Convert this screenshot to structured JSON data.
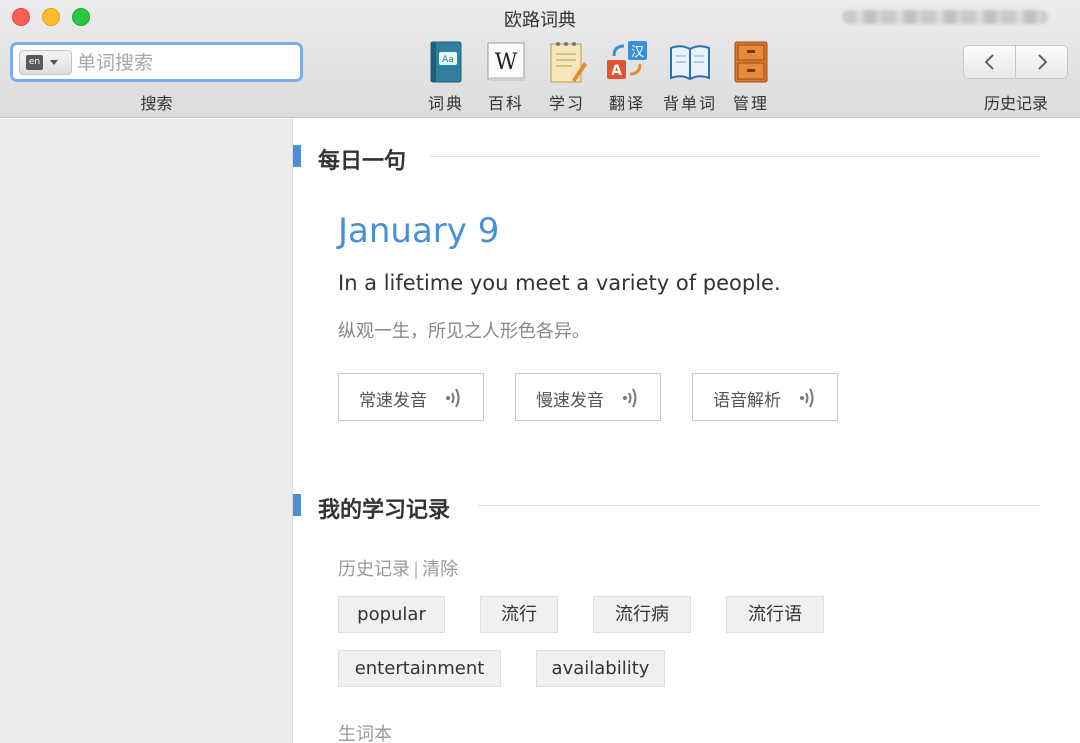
{
  "window": {
    "title": "欧路词典"
  },
  "search": {
    "lang_badge": "en",
    "placeholder": "单词搜索",
    "label": "搜索"
  },
  "toolbar": {
    "tools": [
      {
        "label": "词典",
        "icon": "dictionary-book-icon"
      },
      {
        "label": "百科",
        "icon": "wikipedia-icon"
      },
      {
        "label": "学习",
        "icon": "notepad-pencil-icon"
      },
      {
        "label": "翻译",
        "icon": "translate-icon"
      },
      {
        "label": "背单词",
        "icon": "open-book-icon"
      },
      {
        "label": "管理",
        "icon": "cabinet-icon"
      }
    ],
    "history_label": "历史记录"
  },
  "daily": {
    "section_title": "每日一句",
    "date": "January 9",
    "sentence_en": "In a lifetime you meet a variety of people.",
    "sentence_zh": "纵观一生，所见之人形色各异。",
    "buttons": [
      {
        "label": "常速发音"
      },
      {
        "label": "慢速发音"
      },
      {
        "label": "语音解析"
      }
    ]
  },
  "study": {
    "section_title": "我的学习记录",
    "history_label": "历史记录",
    "clear_label": "清除",
    "history_words": [
      "popular",
      "流行",
      "流行病",
      "流行语",
      "entertainment",
      "availability"
    ],
    "notebook_label": "生词本"
  },
  "colors": {
    "accent": "#4a90d9",
    "search_focus": "#7aaee8"
  }
}
